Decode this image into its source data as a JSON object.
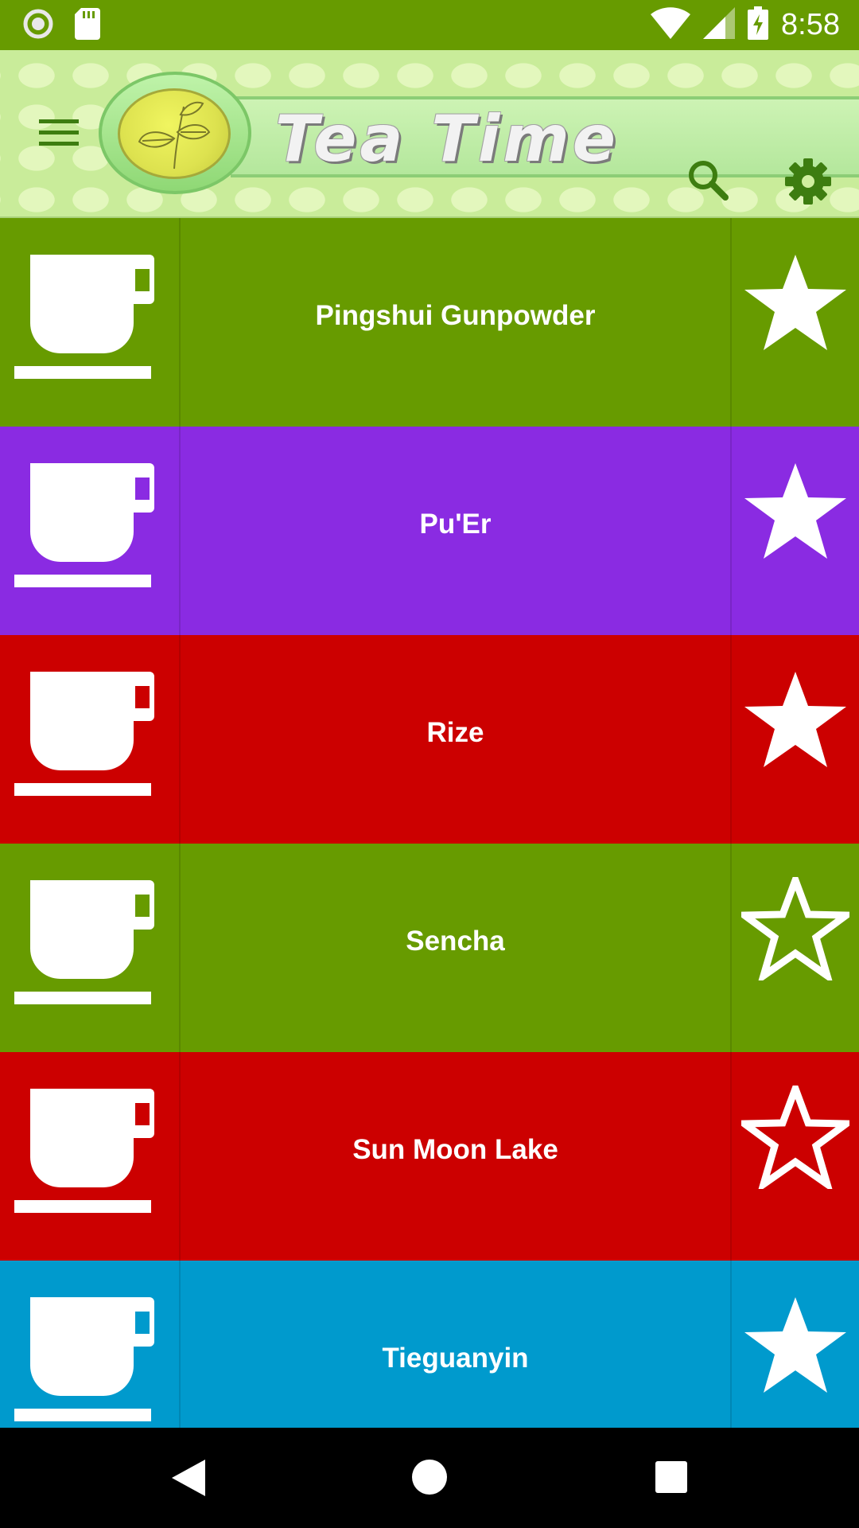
{
  "status_bar": {
    "time": "8:58",
    "icons": [
      "record-icon",
      "sd-card-icon",
      "wifi-icon",
      "signal-icon",
      "battery-charging-icon"
    ]
  },
  "app_bar": {
    "title": "Tea Time",
    "icons": [
      "menu-icon",
      "tea-leaf-logo-icon",
      "search-icon",
      "settings-icon"
    ]
  },
  "teas": [
    {
      "name": "Pingshui Gunpowder",
      "color": "#679b00",
      "favorite": true
    },
    {
      "name": "Pu'Er",
      "color": "#8a2be2",
      "favorite": true
    },
    {
      "name": "Rize",
      "color": "#cc0000",
      "favorite": true
    },
    {
      "name": "Sencha",
      "color": "#679b00",
      "favorite": false
    },
    {
      "name": "Sun Moon Lake",
      "color": "#cc0000",
      "favorite": false
    },
    {
      "name": "Tieguanyin",
      "color": "#009acd",
      "favorite": true
    }
  ],
  "nav_bar": {
    "icons": [
      "back-icon",
      "home-icon",
      "recents-icon"
    ]
  }
}
